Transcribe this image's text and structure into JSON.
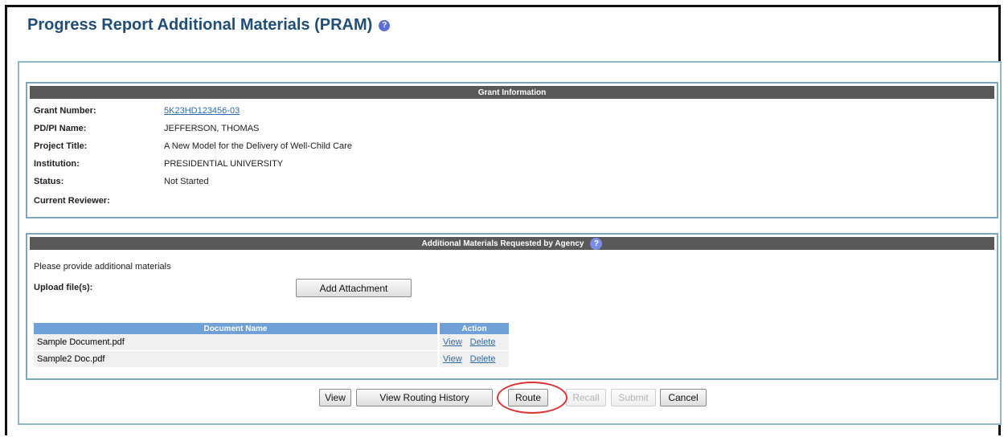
{
  "page": {
    "title": "Progress Report Additional Materials (PRAM)",
    "help_icon": "question-circle-icon"
  },
  "grant_info": {
    "header": "Grant Information",
    "rows": [
      {
        "label": "Grant Number:",
        "value": "5K23HD123456-03",
        "link": true
      },
      {
        "label": "PD/PI Name:",
        "value": "JEFFERSON, THOMAS"
      },
      {
        "label": "Project Title:",
        "value": "A New Model for the Delivery of Well-Child Care"
      },
      {
        "label": "Institution:",
        "value": "PRESIDENTIAL UNIVERSITY"
      },
      {
        "label": "Status:",
        "value": "Not Started"
      },
      {
        "label": "Current Reviewer:",
        "value": ""
      }
    ]
  },
  "materials": {
    "header": "Additional Materials Requested by Agency",
    "instruction": "Please provide additional materials",
    "upload_label": "Upload file(s):",
    "add_attachment_label": "Add Attachment",
    "table": {
      "columns": [
        "Document Name",
        "Action"
      ],
      "rows": [
        {
          "name": "Sample Document.pdf",
          "view": "View",
          "delete": "Delete"
        },
        {
          "name": "Sample2 Doc.pdf",
          "view": "View",
          "delete": "Delete"
        }
      ]
    }
  },
  "actions": {
    "view": "View",
    "view_routing_history": "View Routing History",
    "route": "Route",
    "recall": "Recall",
    "submit": "Submit",
    "cancel": "Cancel"
  },
  "colors": {
    "title": "#1f4e79",
    "section_header": "#595959",
    "table_header": "#6fa0d8",
    "highlight_circle": "#dd3333"
  }
}
